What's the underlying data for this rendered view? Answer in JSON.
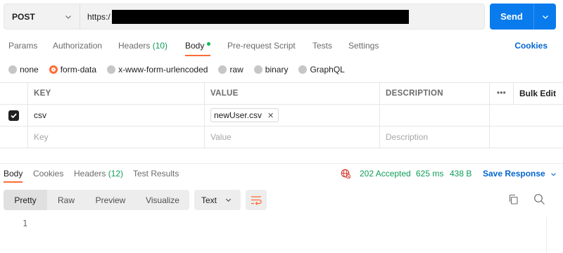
{
  "request": {
    "method": "POST",
    "url_prefix": "https:/",
    "send_label": "Send"
  },
  "request_tabs": [
    {
      "label": "Params"
    },
    {
      "label": "Authorization"
    },
    {
      "label": "Headers",
      "count": "(10)"
    },
    {
      "label": "Body",
      "active": true
    },
    {
      "label": "Pre-request Script"
    },
    {
      "label": "Tests"
    },
    {
      "label": "Settings"
    }
  ],
  "cookies_label": "Cookies",
  "body_types": [
    {
      "label": "none",
      "selected": false
    },
    {
      "label": "form-data",
      "selected": true
    },
    {
      "label": "x-www-form-urlencoded",
      "selected": false
    },
    {
      "label": "raw",
      "selected": false
    },
    {
      "label": "binary",
      "selected": false
    },
    {
      "label": "GraphQL",
      "selected": false
    }
  ],
  "kv_table": {
    "headers": {
      "key": "KEY",
      "value": "VALUE",
      "description": "DESCRIPTION",
      "more": "•••",
      "bulk_edit": "Bulk Edit"
    },
    "rows": [
      {
        "checked": true,
        "key": "csv",
        "file": "newUser.csv",
        "description": ""
      }
    ],
    "placeholders": {
      "key": "Key",
      "value": "Value",
      "description": "Description"
    }
  },
  "response_tabs": [
    {
      "label": "Body",
      "active": true
    },
    {
      "label": "Cookies"
    },
    {
      "label": "Headers",
      "count": "(12)"
    },
    {
      "label": "Test Results"
    }
  ],
  "response_status": {
    "status": "202 Accepted",
    "time": "625 ms",
    "size": "438 B",
    "save_label": "Save Response"
  },
  "view_modes": [
    "Pretty",
    "Raw",
    "Preview",
    "Visualize"
  ],
  "format": "Text",
  "editor": {
    "line_numbers": [
      "1"
    ]
  },
  "colors": {
    "accent_orange": "#ff6c37",
    "send_blue": "#097bed",
    "link_blue": "#0265d2",
    "success_green": "#0f9d58"
  },
  "icons": [
    "chevron-down-icon",
    "check-icon",
    "close-icon",
    "globe-error-icon",
    "wrap-lines-icon",
    "copy-icon",
    "search-icon"
  ]
}
